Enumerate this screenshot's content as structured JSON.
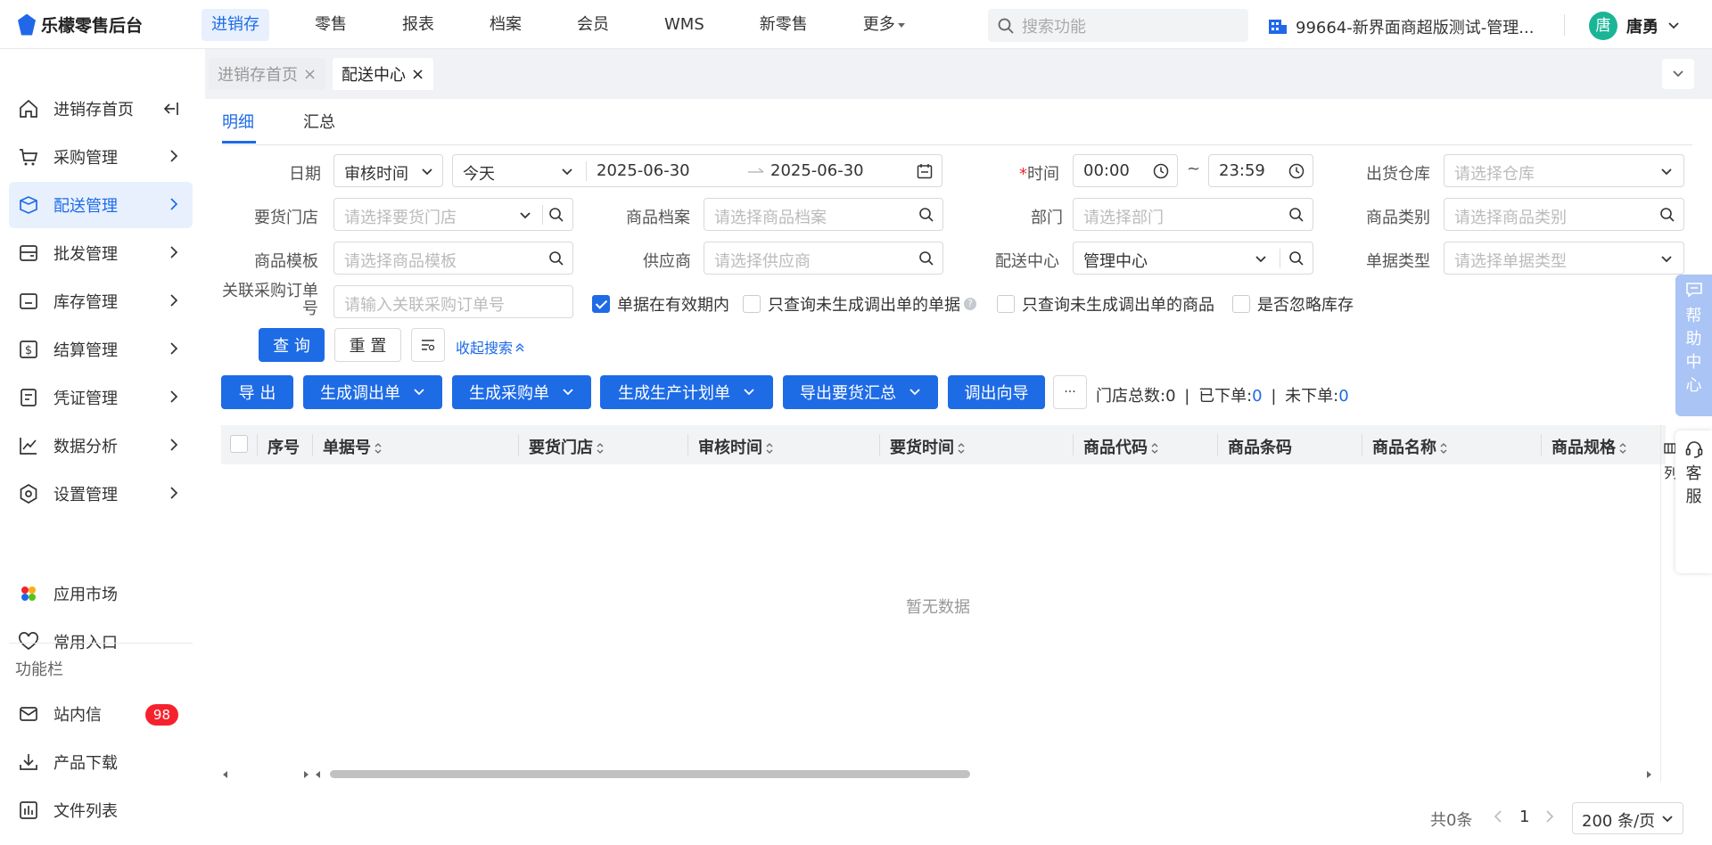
{
  "app": {
    "name": "乐檬零售后台"
  },
  "topnav": {
    "items": [
      "进销存",
      "零售",
      "报表",
      "档案",
      "会员",
      "WMS",
      "新零售",
      "更多"
    ],
    "active_index": 0
  },
  "search": {
    "placeholder": "搜索功能"
  },
  "store": {
    "name": "99664-新界面商超版测试-管理..."
  },
  "user": {
    "avatar_text": "唐",
    "name": "唐勇"
  },
  "sidebar": {
    "items": [
      "进销存首页",
      "采购管理",
      "配送管理",
      "批发管理",
      "库存管理",
      "结算管理",
      "凭证管理",
      "数据分析",
      "设置管理"
    ],
    "extra": [
      "应用市场",
      "常用入口"
    ],
    "section_title": "功能栏",
    "func": [
      "站内信",
      "产品下载",
      "文件列表"
    ],
    "badge": "98"
  },
  "tabs": {
    "items": [
      "进销存首页",
      "配送中心"
    ],
    "close": "×"
  },
  "subtabs": [
    "明细",
    "汇总"
  ],
  "form": {
    "date_label": "日期",
    "date_type": "审核时间",
    "date_range": "今天",
    "date_start": "2025-06-30",
    "date_end": "2025-06-30",
    "time_req": "*",
    "time_label": "时间",
    "time_start": "00:00",
    "time_sep": "~",
    "time_end": "23:59",
    "warehouse_label": "出货仓库",
    "warehouse_ph": "请选择仓库",
    "store_label": "要货门店",
    "store_ph": "请选择要货门店",
    "product_label": "商品档案",
    "product_ph": "请选择商品档案",
    "dept_label": "部门",
    "dept_ph": "请选择部门",
    "category_label": "商品类别",
    "category_ph": "请选择商品类别",
    "template_label": "商品模板",
    "template_ph": "请选择商品模板",
    "supplier_label": "供应商",
    "supplier_ph": "请选择供应商",
    "center_label": "配送中心",
    "center_value": "管理中心",
    "doctype_label": "单据类型",
    "doctype_ph": "请选择单据类型",
    "po_label_1": "关联采购订单",
    "po_label_2": "号",
    "po_ph": "请输入关联采购订单号"
  },
  "checks": [
    {
      "label": "单据在有效期内",
      "checked": true
    },
    {
      "label": "只查询未生成调出单的单据",
      "checked": false
    },
    {
      "label": "只查询未生成调出单的商品",
      "checked": false
    },
    {
      "label": "是否忽略库存",
      "checked": false
    }
  ],
  "actions": {
    "query": "查 询",
    "reset": "重 置",
    "collapse": "收起搜索"
  },
  "toolbar": {
    "buttons": [
      "导 出",
      "生成调出单",
      "生成采购单",
      "生成生产计划单",
      "导出要货汇总",
      "调出向导"
    ],
    "more": "···"
  },
  "stats": {
    "total_label": "门店总数:",
    "total": "0",
    "placed_label": "已下单:",
    "placed": "0",
    "unplaced_label": "未下单:",
    "unplaced": "0",
    "sep": "|"
  },
  "table": {
    "columns": [
      "序号",
      "单据号",
      "要货门店",
      "审核时间",
      "要货时间",
      "商品代码",
      "商品条码",
      "商品名称",
      "商品规格"
    ],
    "empty": "暂无数据",
    "colset": "列"
  },
  "pager": {
    "total": "共0条",
    "page": "1",
    "size": "200 条/页"
  },
  "float": {
    "help": "帮助中心",
    "service": "客服"
  },
  "colors": {
    "primary": "#1e6be6",
    "badge": "#f5222d",
    "avatar": "#19b596"
  }
}
